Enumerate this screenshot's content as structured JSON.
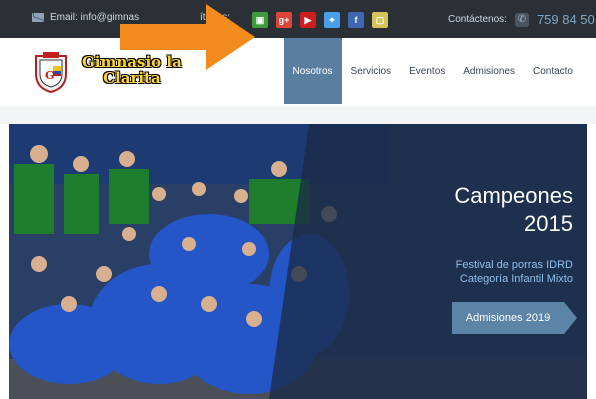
{
  "topbar": {
    "email_label": "Email: info@gimnas",
    "follow_label": "ítanos:",
    "social": [
      {
        "name": "classroom",
        "color": "#3f9b3a",
        "glyph": "▣"
      },
      {
        "name": "google-plus",
        "color": "#db4437",
        "glyph": "g+"
      },
      {
        "name": "youtube",
        "color": "#cc1e1e",
        "glyph": "▶"
      },
      {
        "name": "maps",
        "color": "#4aa0e6",
        "glyph": "⌖"
      },
      {
        "name": "facebook",
        "color": "#4067b3",
        "glyph": "f"
      },
      {
        "name": "other",
        "color": "#d8c25a",
        "glyph": "▢"
      }
    ],
    "contact_label": "Contáctenos:",
    "phone": "759 84 50"
  },
  "header": {
    "brand_line1": "Gimnasio la",
    "brand_line2": "Clarita",
    "nav": [
      "Nosotros",
      "Servicios",
      "Eventos",
      "Admisiones",
      "Contacto"
    ],
    "active_nav": "Nosotros"
  },
  "hero": {
    "title_line1": "Campeones",
    "title_line2": "2015",
    "subtitle_line1": "Festival de porras IDRD",
    "subtitle_line2": "Categoría Infantil Mixto",
    "button_label": "Admisiones 2019"
  },
  "colors": {
    "topbar": "#2b3036",
    "nav_active": "#5a7ea0",
    "button": "#5b84a6",
    "arrow": "#f28a1c"
  }
}
